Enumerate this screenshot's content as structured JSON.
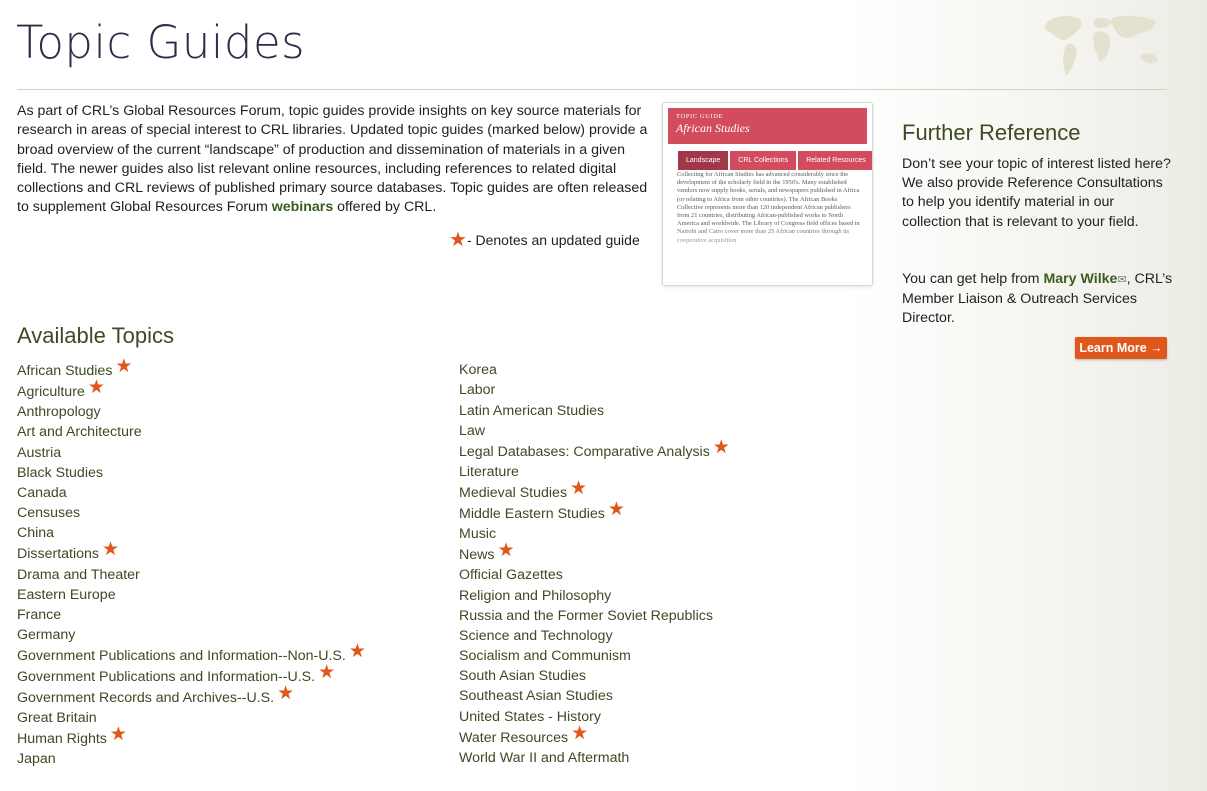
{
  "page": {
    "title": "Topic Guides"
  },
  "intro": {
    "text_before_link": "As part of CRL’s Global Resources Forum, topic guides provide insights on key source materials for research in areas of special interest to CRL libraries. Updated topic guides (marked below) provide a broad overview of the current “landscape” of production and dissemination of materials in a given field. The newer guides also list relevant online resources, including references to related digital collections and CRL reviews of published primary source databases. Topic guides are often released to supplement Global Resources Forum ",
    "link_label": "webinars",
    "text_after_link": " offered by CRL.",
    "legend_label": "-  Denotes an updated guide"
  },
  "guide_preview": {
    "kicker": "TOPIC GUIDE",
    "title": "African Studies",
    "tabs": [
      "Landscape",
      "CRL Collections",
      "Related Resources"
    ],
    "body": "Collecting for African Studies has advanced considerably since the development of the scholarly field in the 1950's. Many established vendors now supply books, serials, and newspapers published in Africa (or relating to Africa from other countries). The African Books Collective represents more than 120 independent African publishers from 21 countries, distributing African-published works to North America and worldwide. The Library of Congress field offices based in Nairobi and Cairo cover more than 25 African countries through its cooperative acquisition"
  },
  "further_reference": {
    "title": "Further Reference",
    "paragraph1": "Don’t see your topic of interest listed here? We also provide Reference Consultations to help you identify material in our collection that is relevant to your field.",
    "paragraph2_before": "You can get help from ",
    "contact_name": "Mary Wilke",
    "paragraph2_after": ", CRL’s Member Liaison & Outreach Services Director.",
    "button_label": "Learn More →"
  },
  "available_topics": {
    "title": "Available Topics",
    "column1": [
      {
        "label": "African Studies",
        "updated": true
      },
      {
        "label": "Agriculture",
        "updated": true
      },
      {
        "label": "Anthropology",
        "updated": false
      },
      {
        "label": "Art and Architecture",
        "updated": false
      },
      {
        "label": "Austria",
        "updated": false
      },
      {
        "label": "Black Studies",
        "updated": false
      },
      {
        "label": "Canada",
        "updated": false
      },
      {
        "label": "Censuses",
        "updated": false
      },
      {
        "label": "China",
        "updated": false
      },
      {
        "label": "Dissertations",
        "updated": true
      },
      {
        "label": "Drama and Theater",
        "updated": false
      },
      {
        "label": "Eastern Europe",
        "updated": false
      },
      {
        "label": "France",
        "updated": false
      },
      {
        "label": "Germany",
        "updated": false
      },
      {
        "label": "Government Publications and Information--Non-U.S.",
        "updated": true
      },
      {
        "label": "Government Publications and Information--U.S.",
        "updated": true
      },
      {
        "label": "Government Records and Archives--U.S.",
        "updated": true
      },
      {
        "label": "Great Britain",
        "updated": false
      },
      {
        "label": "Human Rights",
        "updated": true
      },
      {
        "label": "Japan",
        "updated": false
      }
    ],
    "column2": [
      {
        "label": "Korea",
        "updated": false
      },
      {
        "label": "Labor",
        "updated": false
      },
      {
        "label": "Latin American Studies",
        "updated": false
      },
      {
        "label": "Law",
        "updated": false
      },
      {
        "label": "Legal Databases: Comparative Analysis",
        "updated": true
      },
      {
        "label": "Literature",
        "updated": false
      },
      {
        "label": "Medieval Studies",
        "updated": true
      },
      {
        "label": "Middle Eastern Studies",
        "updated": true
      },
      {
        "label": "Music",
        "updated": false
      },
      {
        "label": "News",
        "updated": true
      },
      {
        "label": "Official Gazettes",
        "updated": false
      },
      {
        "label": "Religion and Philosophy",
        "updated": false
      },
      {
        "label": "Russia and the Former Soviet Republics",
        "updated": false
      },
      {
        "label": "Science and Technology",
        "updated": false
      },
      {
        "label": "Socialism and Communism",
        "updated": false
      },
      {
        "label": "South Asian Studies",
        "updated": false
      },
      {
        "label": "Southeast Asian Studies",
        "updated": false
      },
      {
        "label": "United States - History",
        "updated": false
      },
      {
        "label": "Water Resources",
        "updated": true
      },
      {
        "label": "World War II and Aftermath",
        "updated": false
      }
    ]
  },
  "icons": {
    "updated_marker": "star-icon",
    "email": "envelope-icon",
    "header_decoration": "world-map-icon"
  },
  "colors": {
    "title": "#2f2c4a",
    "link_green": "#3b4b24",
    "accent_orange": "#e0571c",
    "guide_red": "#d24c5e"
  }
}
